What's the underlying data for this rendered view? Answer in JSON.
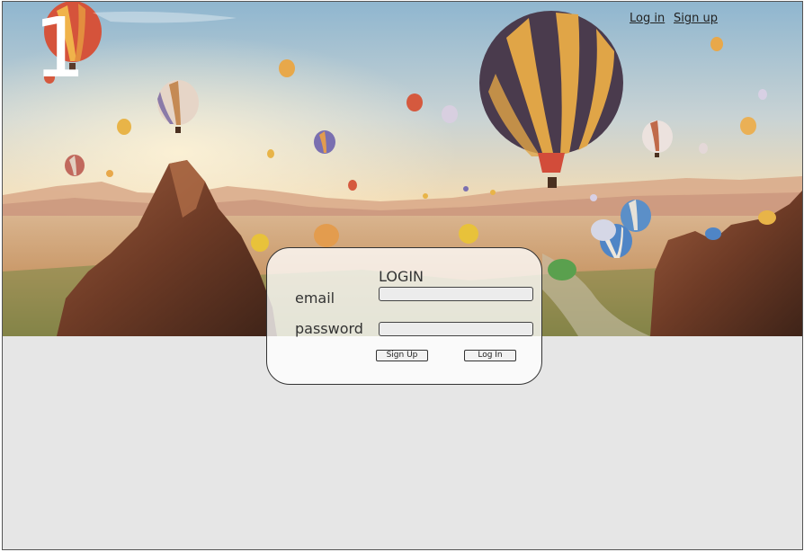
{
  "page": {
    "number": "1"
  },
  "nav": {
    "login_link": "Log in",
    "signup_link": "Sign up"
  },
  "login_form": {
    "title": "LOGIN",
    "email_label": "email",
    "password_label": "password",
    "email_value": "",
    "password_value": "",
    "signup_button": "Sign Up",
    "login_button": "Log In"
  },
  "hero": {
    "image": "hot-air-balloons-over-rocky-valley"
  }
}
